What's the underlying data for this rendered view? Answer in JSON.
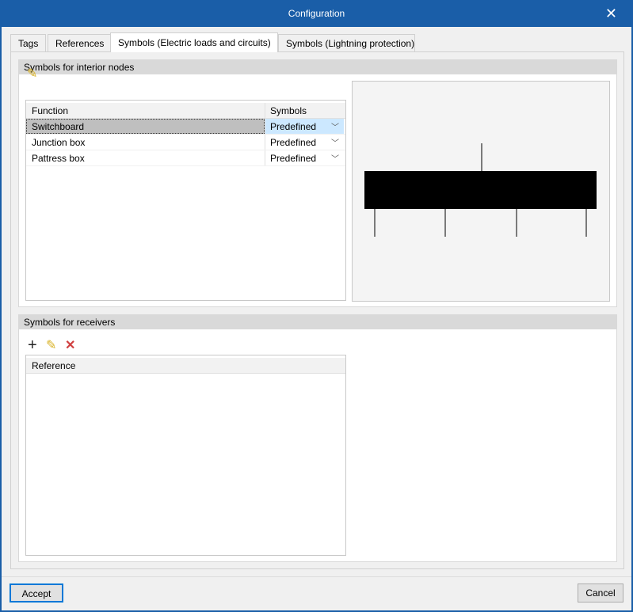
{
  "window": {
    "title": "Configuration"
  },
  "tabs": [
    {
      "label": "Tags"
    },
    {
      "label": "References"
    },
    {
      "label": "Symbols (Electric loads and circuits)"
    },
    {
      "label": "Symbols (Lightning protection)"
    }
  ],
  "interior": {
    "title": "Symbols for interior nodes",
    "columns": [
      "Function",
      "Symbols"
    ],
    "rows": [
      {
        "function": "Switchboard",
        "symbol": "Predefined"
      },
      {
        "function": "Junction box",
        "symbol": "Predefined"
      },
      {
        "function": "Pattress box",
        "symbol": "Predefined"
      }
    ]
  },
  "receivers": {
    "title": "Symbols for receivers",
    "columns": [
      "Reference"
    ]
  },
  "footer": {
    "accept": "Accept",
    "cancel": "Cancel"
  }
}
